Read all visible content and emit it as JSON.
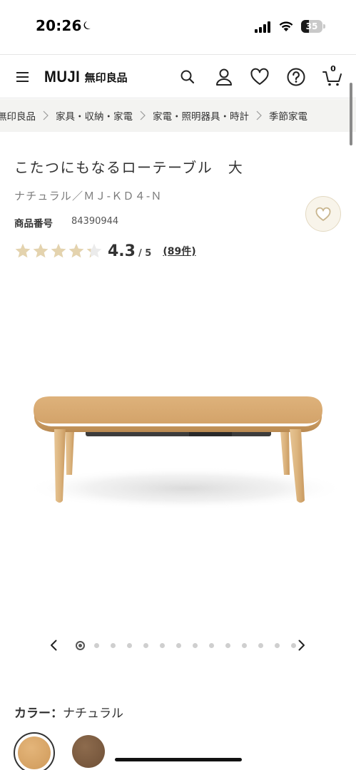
{
  "status_bar": {
    "time": "20:26",
    "battery_level": "35",
    "icons": [
      "moon-icon",
      "signal-icon",
      "wifi-icon",
      "battery-icon"
    ]
  },
  "header": {
    "logo_en": "MUJI",
    "logo_jp": "無印良品",
    "icons": [
      "menu-icon",
      "search-icon",
      "account-icon",
      "heart-icon",
      "help-icon",
      "cart-icon"
    ],
    "cart_count": "0"
  },
  "breadcrumb": {
    "items": [
      "無印良品",
      "家具・収納・家電",
      "家電・照明器具・時計",
      "季節家電"
    ]
  },
  "product": {
    "title": "こたつにもなるローテーブル　大",
    "subtitle": "ナチュラル／ＭＪ-ＫＤ４-Ｎ",
    "number_label": "商品番号",
    "number": "84390944",
    "rating": {
      "value": "4.3",
      "max": "/ 5",
      "score": 4.3,
      "out_of": 5,
      "reviews": "(89件)"
    }
  },
  "carousel": {
    "total_images": 14,
    "current_index": 1
  },
  "color": {
    "label": "カラー：",
    "selected": "ナチュラル",
    "swatches": [
      {
        "name": "natural",
        "color": "#d9a767"
      },
      {
        "name": "brown",
        "color": "#7d5c42"
      }
    ]
  },
  "colors": {
    "star_filled": "#e4d3ae",
    "star_empty": "#ebebeb",
    "breadcrumb_bg": "#f3f3f1",
    "favorite_bg": "#f8f4ea"
  }
}
